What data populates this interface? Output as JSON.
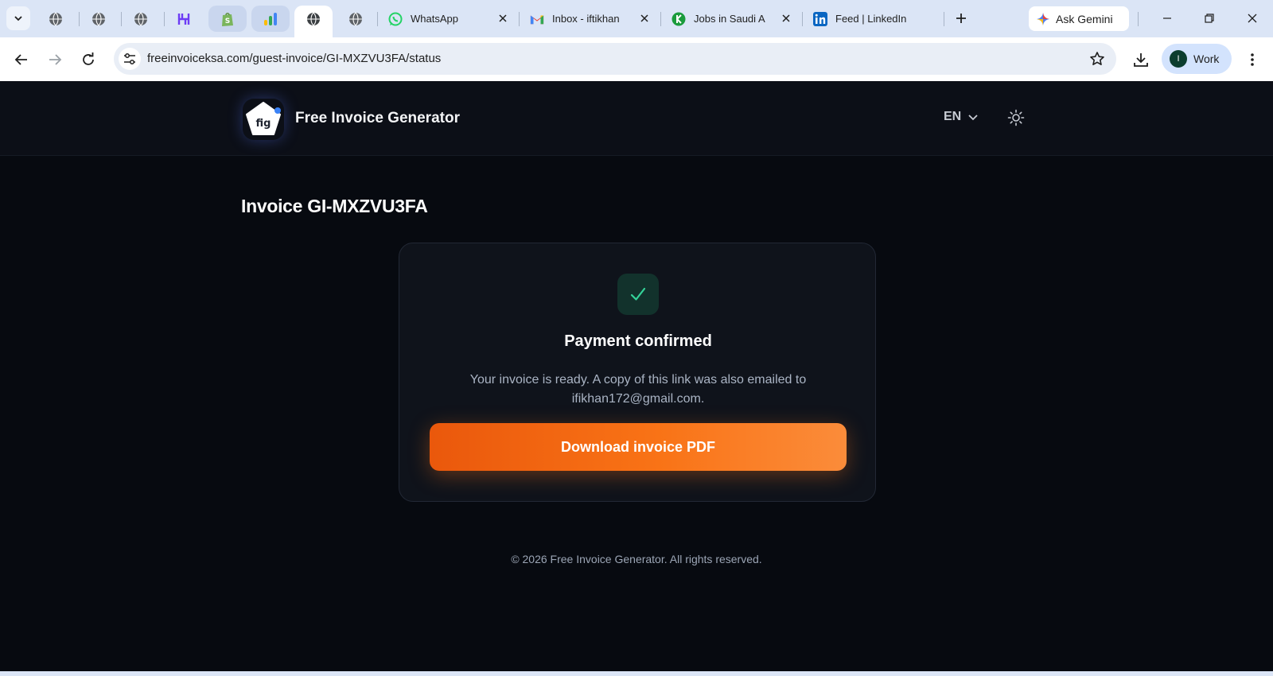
{
  "browser": {
    "tabs": [
      {
        "type": "pinned",
        "icon": "globe-icon"
      },
      {
        "type": "pinned",
        "icon": "globe-icon"
      },
      {
        "type": "pinned",
        "icon": "globe-icon"
      },
      {
        "type": "pinned",
        "icon": "h-brand-icon"
      },
      {
        "type": "pinned",
        "icon": "shopify-icon"
      },
      {
        "type": "pinned",
        "icon": "ads-icon"
      },
      {
        "type": "pinned-active",
        "icon": "globe-icon"
      },
      {
        "type": "pinned",
        "icon": "globe-icon"
      }
    ],
    "wide_tabs": [
      {
        "title": "WhatsApp",
        "icon": "whatsapp-icon"
      },
      {
        "title": "Inbox - iftikhan",
        "icon": "gmail-icon"
      },
      {
        "title": "Jobs in Saudi A",
        "icon": "jobs-icon"
      },
      {
        "title": "Feed | LinkedIn",
        "icon": "linkedin-icon"
      }
    ],
    "gemini_label": "Ask Gemini",
    "url": "freeinvoiceksa.com/guest-invoice/GI-MXZVU3FA/status",
    "profile": {
      "initial": "I",
      "label": "Work"
    }
  },
  "header": {
    "logo_text": "fig",
    "brand": "Free Invoice Generator",
    "language": "EN"
  },
  "main": {
    "title": "Invoice GI-MXZVU3FA",
    "card": {
      "title": "Payment confirmed",
      "message": "Your invoice is ready. A copy of this link was also emailed to ifikhan172@gmail.com.",
      "button_label": "Download invoice PDF"
    }
  },
  "footer": {
    "copyright": "© 2026 Free Invoice Generator. All rights reserved."
  },
  "colors": {
    "accent": "#f97316",
    "success": "#34d399",
    "page_bg": "#070a10"
  }
}
